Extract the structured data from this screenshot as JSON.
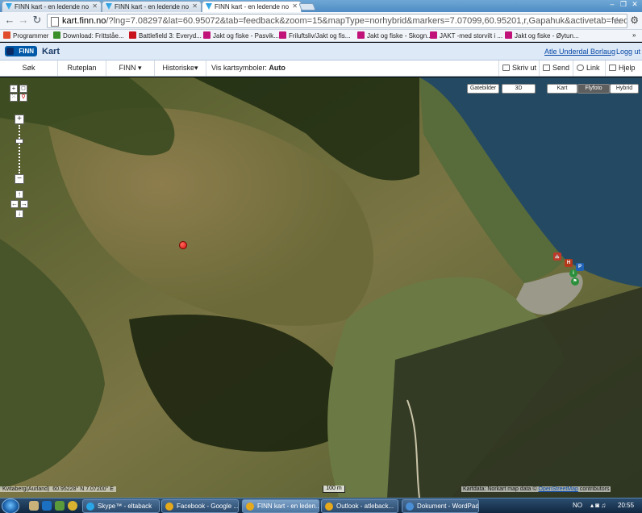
{
  "browser": {
    "tabs": [
      {
        "title": "FINN kart - en ledende no",
        "active": false
      },
      {
        "title": "FINN kart - en ledende no",
        "active": false
      },
      {
        "title": "FINN kart - en ledende no",
        "active": true
      }
    ],
    "url_host": "kart.finn.no",
    "url_rest": "/?lng=7.08297&lat=60.95072&tab=feedback&zoom=15&mapType=norhybrid&markers=7.07099,60.95201,r,Gapahuk&activetab=feedback",
    "bookmarks": [
      {
        "label": "Programmer",
        "color": "#e04b2b"
      },
      {
        "label": "Download: Frittståe...",
        "color": "#3a8f2a"
      },
      {
        "label": "Battlefield 3: Everyd...",
        "color": "#c8121c"
      },
      {
        "label": "Jakt og fiske - Pasvik...",
        "color": "#c1127a"
      },
      {
        "label": "Friluftsliv/Jakt og fis...",
        "color": "#c1127a"
      },
      {
        "label": "Jakt og fiske - Skogn...",
        "color": "#c1127a"
      },
      {
        "label": "JAKT -med storvilt i ...",
        "color": "#c1127a"
      },
      {
        "label": "Jakt og fiske - Øytun...",
        "color": "#c1127a"
      }
    ],
    "bookmarks_overflow": "»"
  },
  "finn": {
    "logo_text": "FINN",
    "section": "Kart",
    "user": "Atle Underdal Borlaug",
    "logout": "Logg ut"
  },
  "toolbar": {
    "items": [
      "Søk",
      "Ruteplan",
      "FINN ▾",
      "Historiske▾"
    ],
    "symbols_label": "Vis kartsymboler:",
    "symbols_value": "Auto ▾",
    "actions": [
      "Skriv ut",
      "Send",
      "Link",
      "Hjelp"
    ]
  },
  "map": {
    "layer_buttons": [
      "Gatebilder",
      "3D"
    ],
    "type_buttons": [
      {
        "label": "Kart",
        "active": false
      },
      {
        "label": "Flyfoto",
        "active": true
      },
      {
        "label": "Hybrid",
        "active": false
      }
    ],
    "zoom_in": "+",
    "zoom_out": "−",
    "scale": "100 m",
    "place": "Kvitaberg(Aurland)",
    "coords": "60.95228° N  7.07200° E",
    "credits_prefix": "Kartdata: Norkart map data ©",
    "credits_link": "OpenStreetMap",
    "credits_suffix": "contributors",
    "marker_color": "#d60f0f"
  },
  "taskbar": {
    "items": [
      {
        "label": "Skype™ - eltaback",
        "color": "#2aa5e6",
        "active": false
      },
      {
        "label": "Facebook - Google ...",
        "color": "#e5a91b",
        "active": false
      },
      {
        "label": "FINN kart - en leden...",
        "color": "#e5a91b",
        "active": true
      },
      {
        "label": "Outlook - atleback...",
        "color": "#e5a91b",
        "active": false
      },
      {
        "label": "Dokument - WordPad",
        "color": "#4a8fd6",
        "active": false
      }
    ],
    "lang": "NO",
    "time": "20:55"
  }
}
